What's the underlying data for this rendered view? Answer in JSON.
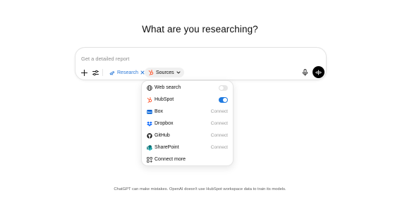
{
  "headline": "What are you researching?",
  "composer": {
    "placeholder": "Get a detailed report",
    "value": "",
    "research_chip": "Research",
    "sources_chip": "Sources"
  },
  "sources_menu": [
    {
      "label": "Web search",
      "icon": "globe-icon",
      "control": "toggle",
      "state": "off"
    },
    {
      "label": "HubSpot",
      "icon": "hubspot-icon",
      "control": "toggle",
      "state": "on"
    },
    {
      "label": "Box",
      "icon": "box-icon",
      "control": "link",
      "action": "Connect"
    },
    {
      "label": "Dropbox",
      "icon": "dropbox-icon",
      "control": "link",
      "action": "Connect"
    },
    {
      "label": "GitHub",
      "icon": "github-icon",
      "control": "link",
      "action": "Connect"
    },
    {
      "label": "SharePoint",
      "icon": "sharepoint-icon",
      "control": "link",
      "action": "Connect"
    },
    {
      "label": "Connect more",
      "icon": "apps-icon",
      "control": "none"
    }
  ],
  "colors": {
    "accent": "#1f7ae0",
    "research_chip": "#2f7bd8",
    "hubspot": "#ff5c35",
    "box": "#0061d5",
    "dropbox": "#0061fe",
    "sharepoint": "#036c70"
  },
  "footer": "ChatGPT can make mistakes. OpenAI doesn't use HubSpot workspace data to train its models."
}
